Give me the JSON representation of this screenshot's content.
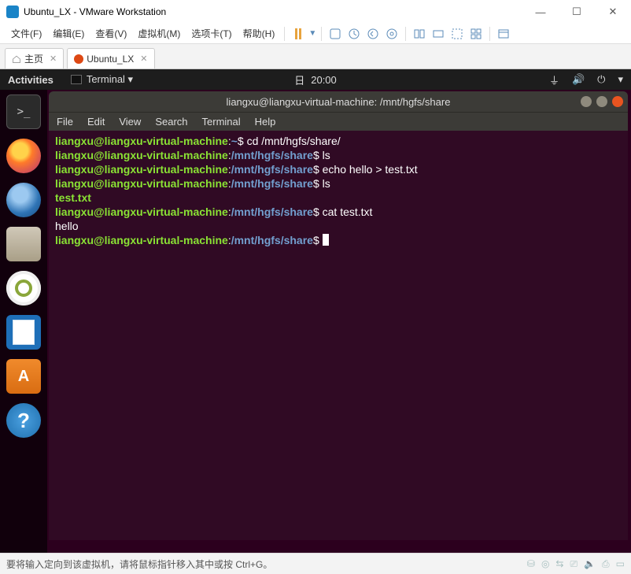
{
  "window": {
    "title": "Ubuntu_LX - VMware Workstation"
  },
  "menubar": {
    "items": [
      "文件(F)",
      "编辑(E)",
      "查看(V)",
      "虚拟机(M)",
      "选项卡(T)",
      "帮助(H)"
    ]
  },
  "tabs": {
    "home": "主页",
    "vm": "Ubuntu_LX"
  },
  "gnome": {
    "activities": "Activities",
    "app_label": "Terminal ▾",
    "clock_day": "日",
    "clock_time": "20:00"
  },
  "terminal": {
    "title": "liangxu@liangxu-virtual-machine: /mnt/hgfs/share",
    "menus": [
      "File",
      "Edit",
      "View",
      "Search",
      "Terminal",
      "Help"
    ],
    "lines": [
      {
        "user": "liangxu@liangxu-virtual-machine",
        "path": "~",
        "sep": ":",
        "end": "$",
        "cmd": " cd /mnt/hgfs/share/"
      },
      {
        "user": "liangxu@liangxu-virtual-machine",
        "path": "/mnt/hgfs/share",
        "sep": ":",
        "end": "$",
        "cmd": " ls"
      },
      {
        "user": "liangxu@liangxu-virtual-machine",
        "path": "/mnt/hgfs/share",
        "sep": ":",
        "end": "$",
        "cmd": " echo hello > test.txt"
      },
      {
        "user": "liangxu@liangxu-virtual-machine",
        "path": "/mnt/hgfs/share",
        "sep": ":",
        "end": "$",
        "cmd": " ls"
      },
      {
        "out": "test.txt",
        "cls": "p-user"
      },
      {
        "user": "liangxu@liangxu-virtual-machine",
        "path": "/mnt/hgfs/share",
        "sep": ":",
        "end": "$",
        "cmd": " cat test.txt"
      },
      {
        "out": "hello",
        "cls": "p-out"
      },
      {
        "user": "liangxu@liangxu-virtual-machine",
        "path": "/mnt/hgfs/share",
        "sep": ":",
        "end": "$",
        "cmd": " ",
        "cursor": true
      }
    ]
  },
  "statusbar": {
    "msg": "要将输入定向到该虚拟机，请将鼠标指针移入其中或按 Ctrl+G。"
  }
}
